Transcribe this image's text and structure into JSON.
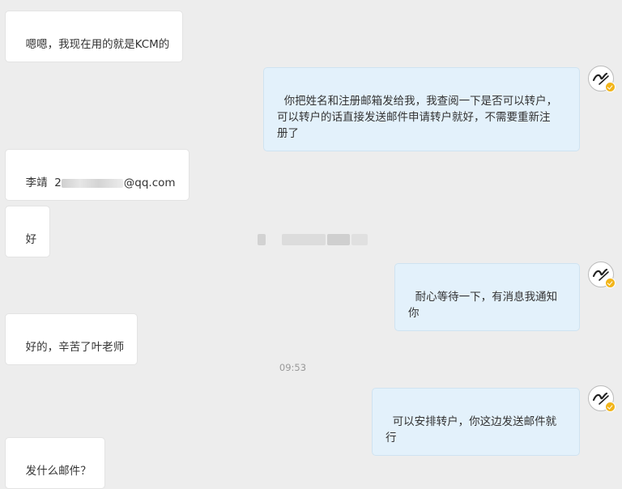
{
  "messages": [
    {
      "text": "嗯嗯，我现在用的就是KCM的"
    },
    {
      "text": "你把姓名和注册邮箱发给我，我查阅一下是否可以转户，\n可以转户的话直接发送邮件申请转户就好，不需要重新注\n册了"
    },
    {
      "name": "李靖",
      "email_prefix": "2",
      "email_suffix": "@qq.com"
    },
    {
      "text": "好"
    },
    {
      "text": "耐心等待一下，有消息我通知你"
    },
    {
      "text": "好的，辛苦了叶老师"
    },
    {
      "text": "可以安排转户，你这边发送邮件就行"
    },
    {
      "text": "发什么邮件？"
    }
  ],
  "timestamp": "09:53"
}
